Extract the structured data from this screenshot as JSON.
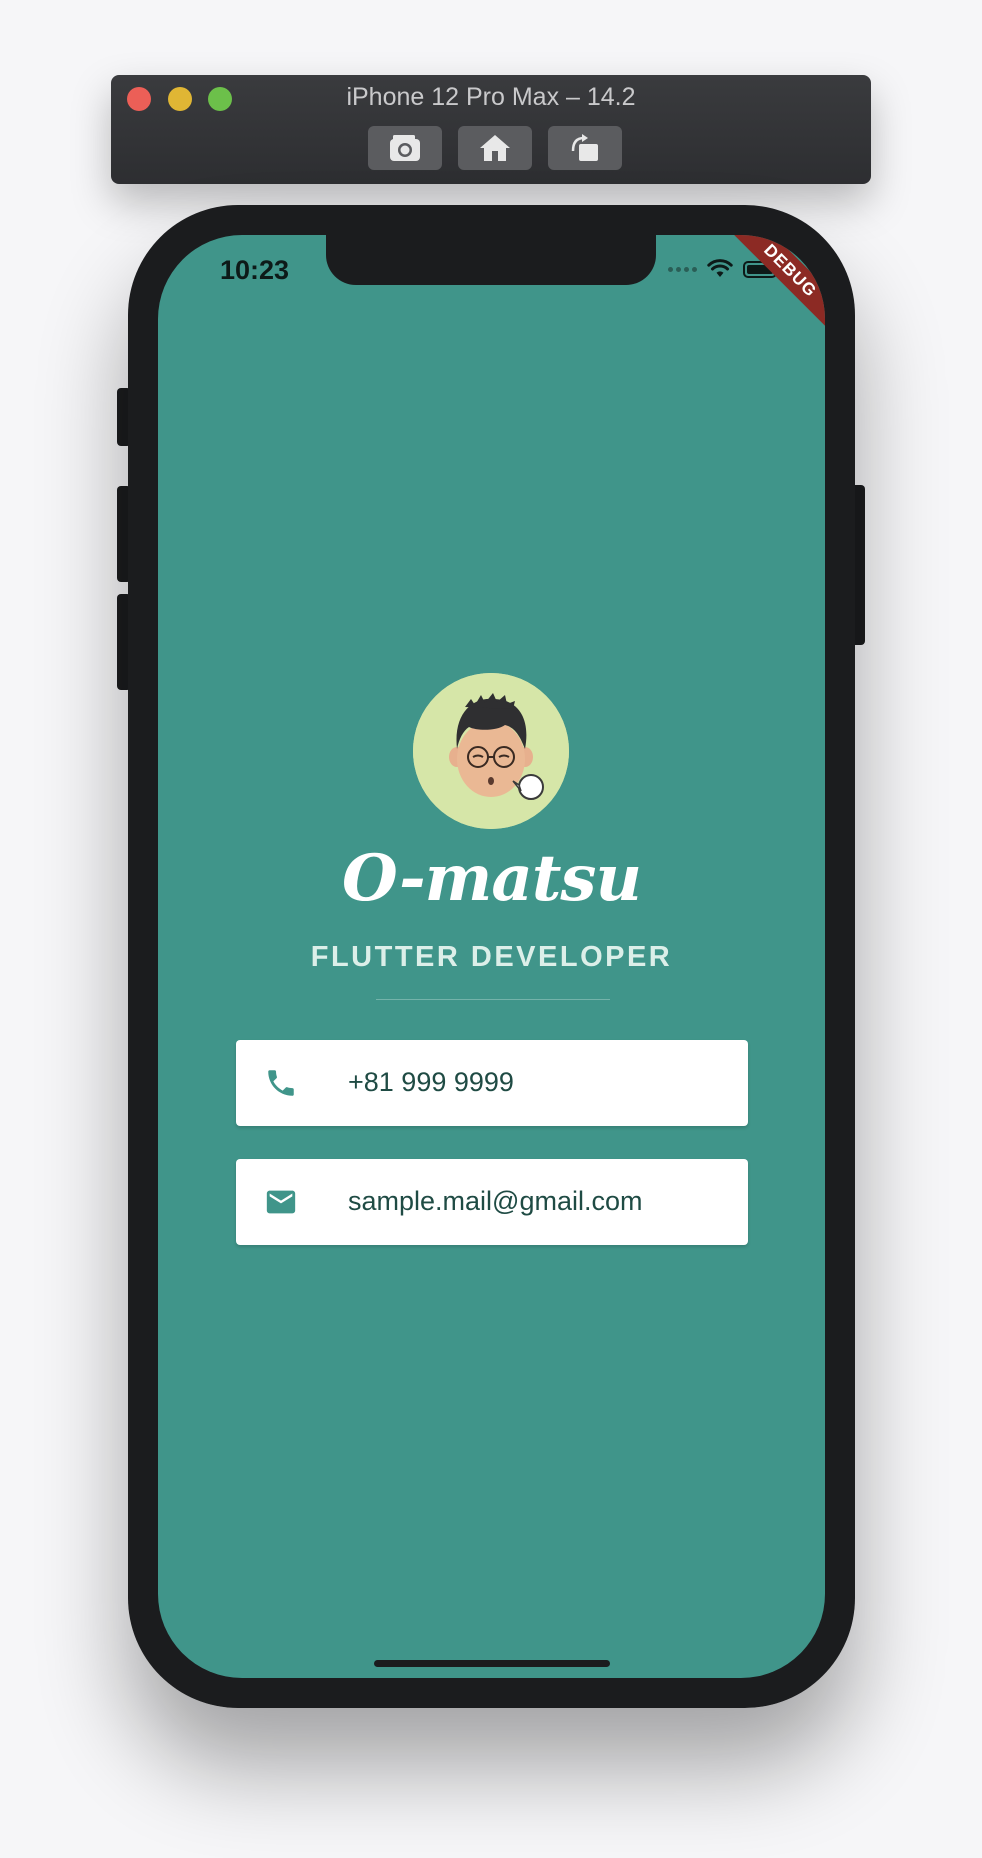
{
  "simulator": {
    "title": "iPhone 12 Pro Max – 14.2",
    "buttons": [
      {
        "icon": "screenshot-camera-icon"
      },
      {
        "icon": "home-icon"
      },
      {
        "icon": "rotate-icon"
      }
    ]
  },
  "status_bar": {
    "time": "10:23",
    "icons": [
      "cellular-signal-icon",
      "wifi-icon",
      "battery-icon"
    ]
  },
  "debug_banner": "DEBUG",
  "profile": {
    "avatar_icon": "avatar-illustration",
    "name": "O-matsu",
    "role": "FLUTTER DEVELOPER"
  },
  "contacts": {
    "phone": {
      "icon": "phone-icon",
      "value": "+81 999 9999"
    },
    "email": {
      "icon": "mail-icon",
      "value": "sample.mail@gmail.com"
    }
  },
  "colors": {
    "background": "#40958a",
    "card": "#ffffff",
    "text_dark": "#1f4b44",
    "avatar_bg": "#d6e6a8",
    "debug_banner": "#8c2a24"
  }
}
